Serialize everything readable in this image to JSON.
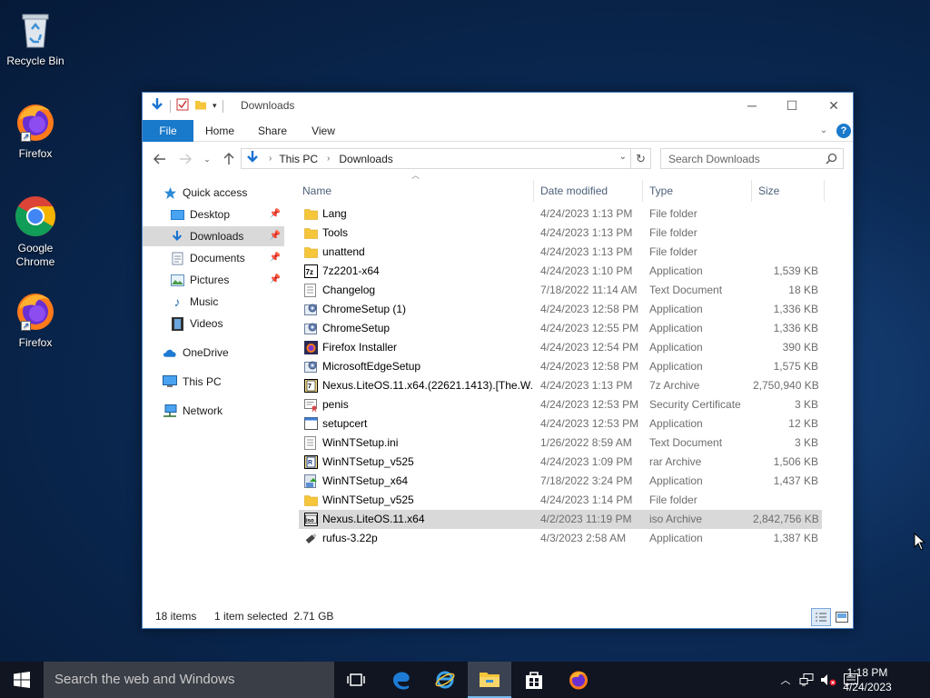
{
  "desktop": {
    "icons": [
      {
        "label": "Recycle Bin",
        "icon": "recycle-bin-icon"
      },
      {
        "label": "Firefox",
        "icon": "firefox-icon"
      },
      {
        "label": "Google Chrome",
        "icon": "chrome-icon"
      },
      {
        "label": "Firefox",
        "icon": "firefox-icon"
      }
    ]
  },
  "window": {
    "title": "Downloads",
    "ribbon_tabs": [
      "File",
      "Home",
      "Share",
      "View"
    ],
    "breadcrumb": [
      "This PC",
      "Downloads"
    ],
    "search_placeholder": "Search Downloads",
    "help": "?"
  },
  "navpane": {
    "items": [
      {
        "label": "Quick access",
        "icon": "star-icon",
        "pinned": false
      },
      {
        "label": "Desktop",
        "icon": "desktop-folder-icon",
        "pinned": true
      },
      {
        "label": "Downloads",
        "icon": "download-arrow-icon",
        "pinned": true,
        "selected": true
      },
      {
        "label": "Documents",
        "icon": "documents-icon",
        "pinned": true
      },
      {
        "label": "Pictures",
        "icon": "pictures-icon",
        "pinned": true
      },
      {
        "label": "Music",
        "icon": "music-icon",
        "pinned": false
      },
      {
        "label": "Videos",
        "icon": "videos-icon",
        "pinned": false
      },
      {
        "label": "OneDrive",
        "icon": "onedrive-cloud-icon",
        "pinned": false
      },
      {
        "label": "This PC",
        "icon": "this-pc-icon",
        "pinned": false
      },
      {
        "label": "Network",
        "icon": "network-icon",
        "pinned": false
      }
    ]
  },
  "filelist": {
    "columns": [
      "Name",
      "Date modified",
      "Type",
      "Size"
    ],
    "rows": [
      {
        "name": "Lang",
        "date": "4/24/2023 1:13 PM",
        "type": "File folder",
        "size": "",
        "icon": "folder"
      },
      {
        "name": "Tools",
        "date": "4/24/2023 1:13 PM",
        "type": "File folder",
        "size": "",
        "icon": "folder"
      },
      {
        "name": "unattend",
        "date": "4/24/2023 1:13 PM",
        "type": "File folder",
        "size": "",
        "icon": "folder"
      },
      {
        "name": "7z2201-x64",
        "date": "4/24/2023 1:10 PM",
        "type": "Application",
        "size": "1,539 KB",
        "icon": "app-7z"
      },
      {
        "name": "Changelog",
        "date": "7/18/2022 11:14 AM",
        "type": "Text Document",
        "size": "18 KB",
        "icon": "text"
      },
      {
        "name": "ChromeSetup (1)",
        "date": "4/24/2023 12:58 PM",
        "type": "Application",
        "size": "1,336 KB",
        "icon": "setup"
      },
      {
        "name": "ChromeSetup",
        "date": "4/24/2023 12:55 PM",
        "type": "Application",
        "size": "1,336 KB",
        "icon": "setup"
      },
      {
        "name": "Firefox Installer",
        "date": "4/24/2023 12:54 PM",
        "type": "Application",
        "size": "390 KB",
        "icon": "firefox-installer"
      },
      {
        "name": "MicrosoftEdgeSetup",
        "date": "4/24/2023 12:58 PM",
        "type": "Application",
        "size": "1,575 KB",
        "icon": "setup"
      },
      {
        "name": "Nexus.LiteOS.11.x64.(22621.1413).[The.W...",
        "date": "4/24/2023 1:13 PM",
        "type": "7z Archive",
        "size": "2,750,940 KB",
        "icon": "archive-7z"
      },
      {
        "name": "penis",
        "date": "4/24/2023 12:53 PM",
        "type": "Security Certificate",
        "size": "3 KB",
        "icon": "certificate"
      },
      {
        "name": "setupcert",
        "date": "4/24/2023 12:53 PM",
        "type": "Application",
        "size": "12 KB",
        "icon": "window-app"
      },
      {
        "name": "WinNTSetup.ini",
        "date": "1/26/2022 8:59 AM",
        "type": "Text Document",
        "size": "3 KB",
        "icon": "text"
      },
      {
        "name": "WinNTSetup_v525",
        "date": "4/24/2023 1:09 PM",
        "type": "rar Archive",
        "size": "1,506 KB",
        "icon": "archive-rar"
      },
      {
        "name": "WinNTSetup_x64",
        "date": "7/18/2022 3:24 PM",
        "type": "Application",
        "size": "1,437 KB",
        "icon": "winnt-app"
      },
      {
        "name": "WinNTSetup_v525",
        "date": "4/24/2023 1:14 PM",
        "type": "File folder",
        "size": "",
        "icon": "folder"
      },
      {
        "name": "Nexus.LiteOS.11.x64",
        "date": "4/2/2023 11:19 PM",
        "type": "iso Archive",
        "size": "2,842,756 KB",
        "icon": "archive-iso",
        "selected": true
      },
      {
        "name": "rufus-3.22p",
        "date": "4/3/2023 2:58 AM",
        "type": "Application",
        "size": "1,387 KB",
        "icon": "usb-drive"
      }
    ]
  },
  "statusbar": {
    "items_count": "18 items",
    "selection": "1 item selected  2.71 GB"
  },
  "taskbar": {
    "search_placeholder": "Search the web and Windows",
    "time": "1:18 PM",
    "date": "4/24/2023"
  }
}
